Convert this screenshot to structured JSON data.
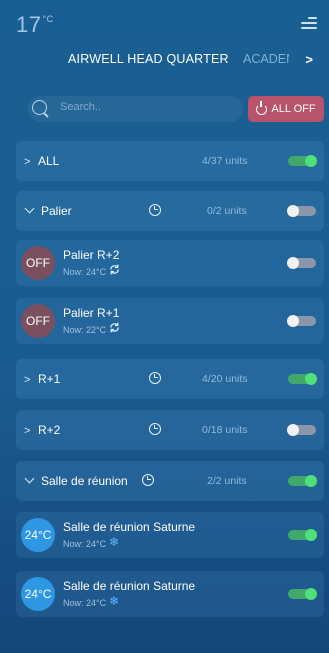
{
  "header": {
    "temperature": "17",
    "temperature_unit": "°C",
    "tabs": [
      {
        "label": "AIRWELL HEAD QUARTER",
        "active": true
      },
      {
        "label": "ACADEMY",
        "active": false
      }
    ]
  },
  "search": {
    "placeholder": "Search.."
  },
  "all_off_label": "ALL OFF",
  "groups": {
    "all": {
      "label": "ALL",
      "units": "4/37 units",
      "on": true
    },
    "palier": {
      "label": "Palier",
      "units": "0/2 units",
      "on": false
    },
    "r1": {
      "label": "R+1",
      "units": "4/20 units",
      "on": true
    },
    "r2": {
      "label": "R+2",
      "units": "0/18 units",
      "on": false
    },
    "salle": {
      "label": "Salle de réunion",
      "units": "2/2 units",
      "on": true
    }
  },
  "devices": {
    "palier_r2": {
      "badge": "OFF",
      "name": "Palier R+2",
      "now": "Now: 24°C",
      "mode_icon": "sync-icon",
      "on": false
    },
    "palier_r1": {
      "badge": "OFF",
      "name": "Palier R+1",
      "now": "Now: 22°C",
      "mode_icon": "sync-icon",
      "on": false
    },
    "saturne_1": {
      "badge": "24°C",
      "name": "Salle de réunion Saturne",
      "now": "Now: 24°C",
      "mode_icon": "snowflake-icon",
      "on": true
    },
    "saturne_2": {
      "badge": "24°C",
      "name": "Salle de réunion Saturne",
      "now": "Now: 24°C",
      "mode_icon": "snowflake-icon",
      "on": true
    }
  },
  "colors": {
    "background": "#1b5c90",
    "all_off_button": "#b8536c",
    "toggle_on": "#4fe07a",
    "cool_badge": "#2d97e3",
    "off_badge": "#7a5060"
  }
}
